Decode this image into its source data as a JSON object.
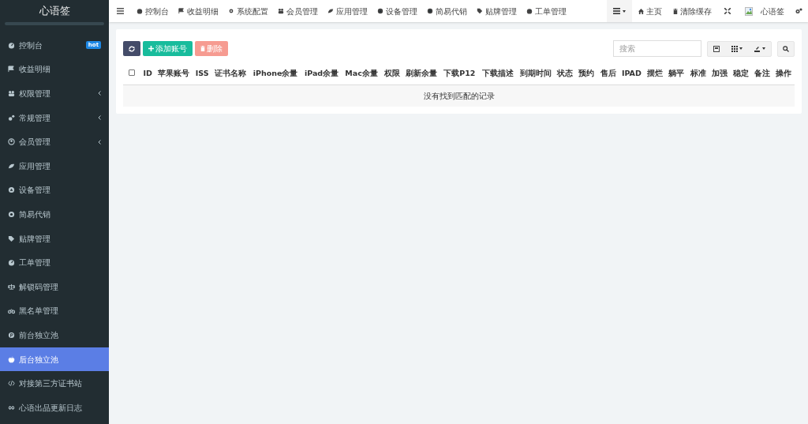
{
  "sidebar": {
    "logo": "心语签",
    "items": [
      {
        "label": "控制台",
        "badge": "hot",
        "expandable": false,
        "selected": false
      },
      {
        "label": "收益明细",
        "expandable": false,
        "selected": false
      },
      {
        "label": "权限管理",
        "expandable": true,
        "selected": false
      },
      {
        "label": "常规管理",
        "expandable": true,
        "selected": false
      },
      {
        "label": "会员管理",
        "expandable": true,
        "selected": false
      },
      {
        "label": "应用管理",
        "expandable": false,
        "selected": false
      },
      {
        "label": "设备管理",
        "expandable": false,
        "selected": false
      },
      {
        "label": "简易代销",
        "expandable": false,
        "selected": false
      },
      {
        "label": "贴牌管理",
        "expandable": false,
        "selected": false
      },
      {
        "label": "工单管理",
        "expandable": false,
        "selected": false
      },
      {
        "label": "解锁码管理",
        "expandable": false,
        "selected": false
      },
      {
        "label": "黑名单管理",
        "expandable": false,
        "selected": false
      },
      {
        "label": "前台独立池",
        "expandable": false,
        "selected": false
      },
      {
        "label": "后台独立池",
        "expandable": false,
        "selected": true
      },
      {
        "label": "对接第三方证书站",
        "expandable": false,
        "selected": false
      },
      {
        "label": "心语出品更新日志",
        "expandable": false,
        "selected": false
      }
    ]
  },
  "top_nav": {
    "tabs": [
      "控制台",
      "收益明细",
      "系统配置",
      "会员管理",
      "应用管理",
      "设备管理",
      "简易代销",
      "贴牌管理",
      "工单管理"
    ],
    "home": "主页",
    "clear_cache": "清除缓存",
    "user": "心语签"
  },
  "toolbar": {
    "add": "添加账号",
    "delete": "删除",
    "search": {
      "placeholder": "搜索"
    }
  },
  "table": {
    "select_all_checked": false,
    "columns": [
      "ID",
      "苹果账号",
      "ISS",
      "证书名称",
      "iPhone余量",
      "iPad余量",
      "Mac余量",
      "权限",
      "刷新余量",
      "下载P12",
      "下载描述",
      "到期时间",
      "状态",
      "预约",
      "售后",
      "IPAD",
      "摆烂",
      "躺平",
      "标准",
      "加强",
      "稳定",
      "备注",
      "操作"
    ],
    "empty_message": "没有找到匹配的记录"
  }
}
